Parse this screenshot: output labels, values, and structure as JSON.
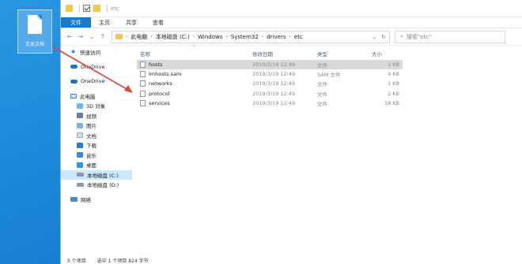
{
  "desktop": {
    "file_icon_label": "文本文档",
    "annotation_arrow_color": "#e0443e"
  },
  "window": {
    "title": "etc",
    "ribbon_tabs": [
      "文件",
      "主页",
      "共享",
      "查看"
    ],
    "address": {
      "crumbs": [
        "此电脑",
        "本地磁盘 (C:)",
        "Windows",
        "System32",
        "drivers",
        "etc"
      ]
    },
    "search_placeholder": "搜索\"etc\""
  },
  "nav": {
    "items": [
      {
        "label": "快速访问",
        "icon": "star-icon",
        "level": "level1",
        "selected": false
      },
      {
        "label": "OneDrive",
        "icon": "cloud-icon",
        "level": "level1",
        "selected": false
      },
      {
        "label": "OneDrive",
        "icon": "cloud-icon",
        "level": "level1",
        "selected": false
      },
      {
        "label": "此电脑",
        "icon": "pc-icon",
        "level": "level1",
        "selected": false
      },
      {
        "label": "3D 对象",
        "icon": "3d-objects-icon",
        "level": "child",
        "selected": false
      },
      {
        "label": "视频",
        "icon": "video-icon",
        "level": "child",
        "selected": false
      },
      {
        "label": "图片",
        "icon": "pictures-icon",
        "level": "child",
        "selected": false
      },
      {
        "label": "文档",
        "icon": "documents-icon",
        "level": "child",
        "selected": false
      },
      {
        "label": "下载",
        "icon": "download-icon",
        "level": "child",
        "selected": false
      },
      {
        "label": "音乐",
        "icon": "music-icon",
        "level": "child",
        "selected": false
      },
      {
        "label": "桌面",
        "icon": "desktop-icon",
        "level": "child",
        "selected": false
      },
      {
        "label": "本地磁盘 (C:)",
        "icon": "drive-icon",
        "level": "child",
        "selected": true
      },
      {
        "label": "本地磁盘 (D:)",
        "icon": "drive-icon",
        "level": "child",
        "selected": false
      },
      {
        "label": "网络",
        "icon": "network-icon",
        "level": "level1",
        "selected": false
      }
    ]
  },
  "columns": {
    "name": "名称",
    "date": "修改日期",
    "type": "类型",
    "size": "大小"
  },
  "files": [
    {
      "name": "hosts",
      "date": "2019/3/19 12:49",
      "type": "文件",
      "size": "1 KB",
      "selected": true
    },
    {
      "name": "lmhosts.sam",
      "date": "2019/3/19 12:49",
      "type": "SAM 文件",
      "size": "4 KB",
      "selected": false
    },
    {
      "name": "networks",
      "date": "2019/3/19 12:49",
      "type": "文件",
      "size": "1 KB",
      "selected": false
    },
    {
      "name": "protocol",
      "date": "2019/3/19 12:49",
      "type": "文件",
      "size": "2 KB",
      "selected": false
    },
    {
      "name": "services",
      "date": "2019/3/19 12:49",
      "type": "文件",
      "size": "18 KB",
      "selected": false
    }
  ],
  "status": {
    "item_count": "5 个项目",
    "selection": "选中 1 个项目 824 字节"
  }
}
